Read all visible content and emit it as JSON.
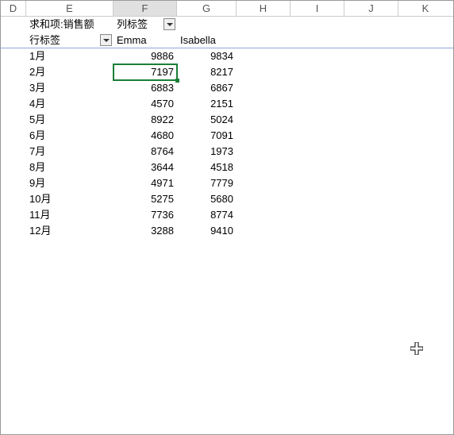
{
  "columns": [
    "D",
    "E",
    "F",
    "G",
    "H",
    "I",
    "J",
    "K"
  ],
  "pivot": {
    "value_field_label": "求和项:销售额",
    "column_label": "列标签",
    "row_label": "行标签",
    "col_headers": [
      "Emma",
      "Isabella"
    ]
  },
  "rows": [
    {
      "label": "1月",
      "v": [
        9886,
        9834
      ]
    },
    {
      "label": "2月",
      "v": [
        7197,
        8217
      ]
    },
    {
      "label": "3月",
      "v": [
        6883,
        6867
      ]
    },
    {
      "label": "4月",
      "v": [
        4570,
        2151
      ]
    },
    {
      "label": "5月",
      "v": [
        8922,
        5024
      ]
    },
    {
      "label": "6月",
      "v": [
        4680,
        7091
      ]
    },
    {
      "label": "7月",
      "v": [
        8764,
        1973
      ]
    },
    {
      "label": "8月",
      "v": [
        3644,
        4518
      ]
    },
    {
      "label": "9月",
      "v": [
        4971,
        7779
      ]
    },
    {
      "label": "10月",
      "v": [
        5275,
        5680
      ]
    },
    {
      "label": "11月",
      "v": [
        7736,
        8774
      ]
    },
    {
      "label": "12月",
      "v": [
        3288,
        9410
      ]
    }
  ],
  "selected": {
    "col": "F",
    "row_index": 1
  },
  "chart_data": {
    "type": "table",
    "title": "求和项:销售额",
    "row_field": "行标签",
    "column_field": "列标签",
    "categories": [
      "1月",
      "2月",
      "3月",
      "4月",
      "5月",
      "6月",
      "7月",
      "8月",
      "9月",
      "10月",
      "11月",
      "12月"
    ],
    "series": [
      {
        "name": "Emma",
        "values": [
          9886,
          7197,
          6883,
          4570,
          8922,
          4680,
          8764,
          3644,
          4971,
          5275,
          7736,
          3288
        ]
      },
      {
        "name": "Isabella",
        "values": [
          9834,
          8217,
          6867,
          2151,
          5024,
          7091,
          1973,
          4518,
          7779,
          5680,
          8774,
          9410
        ]
      }
    ]
  }
}
